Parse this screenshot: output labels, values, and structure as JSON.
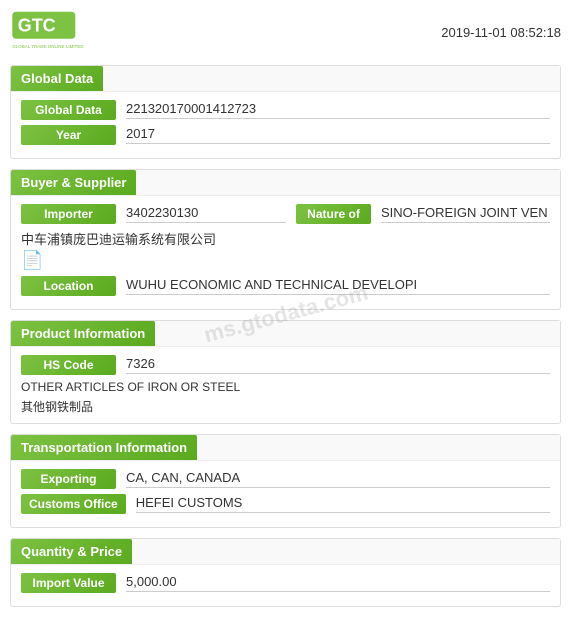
{
  "timestamp": "2019-11-01 08:52:18",
  "logo": {
    "alt": "Global Trade Online Limited"
  },
  "watermark": "ms.gtodata.com",
  "sections": {
    "globalData": {
      "header": "Global Data",
      "fields": {
        "globalData_label": "Global Data",
        "globalData_value": "221320170001412723",
        "year_label": "Year",
        "year_value": "2017"
      }
    },
    "buyerSupplier": {
      "header": "Buyer & Supplier",
      "importer_label": "Importer",
      "importer_value": "3402230130",
      "nature_label": "Nature of",
      "nature_value": "SINO-FOREIGN JOINT VEN",
      "chinese_name": "中车浦镇庞巴迪运输系统有限公司",
      "doc_icon": "📄",
      "location_label": "Location",
      "location_value": "WUHU ECONOMIC AND TECHNICAL DEVELOPI"
    },
    "productInfo": {
      "header": "Product Information",
      "hs_label": "HS Code",
      "hs_value": "7326",
      "desc_en": "OTHER ARTICLES OF IRON OR STEEL",
      "desc_cn": "其他钢铁制品"
    },
    "transportation": {
      "header": "Transportation Information",
      "exporting_label": "Exporting",
      "exporting_value": "CA, CAN, CANADA",
      "customs_label": "Customs Office",
      "customs_value": "HEFEI CUSTOMS"
    },
    "quantityPrice": {
      "header": "Quantity & Price",
      "importValue_label": "Import Value",
      "importValue_value": "5,000.00"
    }
  }
}
